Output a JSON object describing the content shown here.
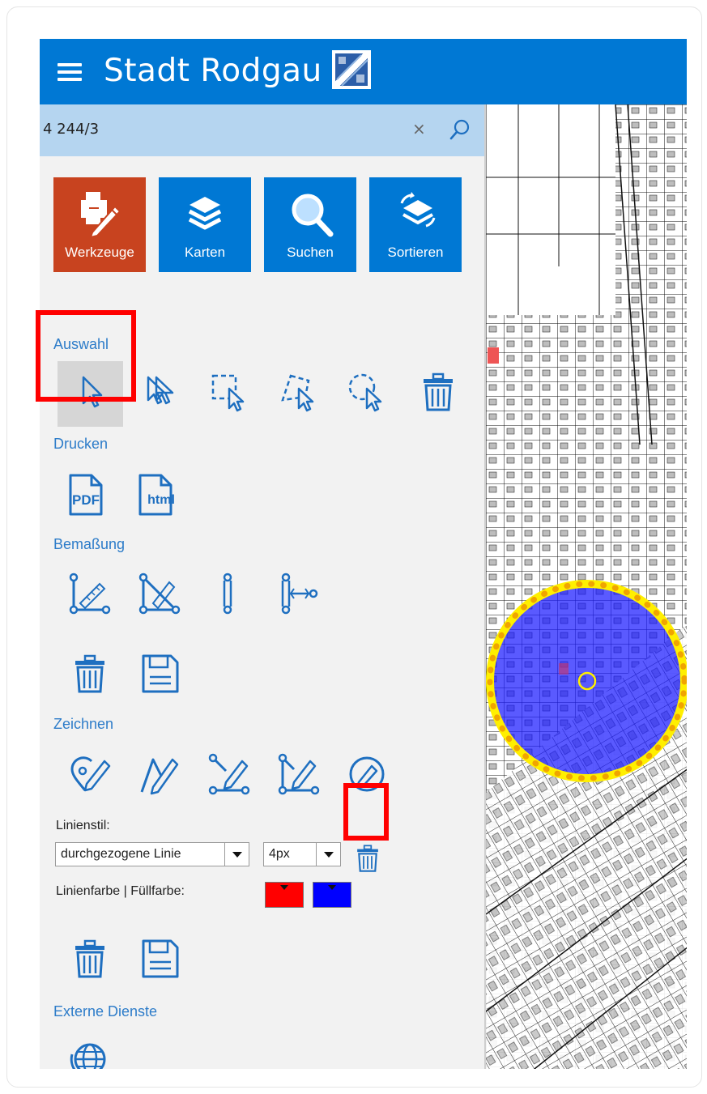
{
  "header": {
    "title": "Stadt Rodgau",
    "menu_icon": "hamburger-icon",
    "logo": "city-logo",
    "bar_color": "#0078d4"
  },
  "search": {
    "value": "4 244/3",
    "clear_label": "×",
    "icon": "search-icon"
  },
  "tiles": [
    {
      "label": "Werkzeuge",
      "icon": "tools-icon",
      "color": "#c8431f",
      "active": true
    },
    {
      "label": "Karten",
      "icon": "layers-icon",
      "color": "#0078d4"
    },
    {
      "label": "Suchen",
      "icon": "magnifier-icon",
      "color": "#0078d4"
    },
    {
      "label": "Sortieren",
      "icon": "sort-layers-icon",
      "color": "#0078d4"
    }
  ],
  "sections": {
    "auswahl": "Auswahl",
    "drucken": "Drucken",
    "bemassung": "Bemaßung",
    "zeichnen": "Zeichnen",
    "externe": "Externe Dienste"
  },
  "drucken": {
    "pdf_label": "PDF",
    "html_label": "html"
  },
  "style": {
    "linienstil_label": "Linienstil:",
    "line_style_value": "durchgezogene Linie",
    "line_width_value": "4px",
    "colors_label": "Linienfarbe | Füllfarbe:",
    "line_color": "#ff0000",
    "fill_color": "#0000ff"
  },
  "accent_color": "#2d7cc9"
}
